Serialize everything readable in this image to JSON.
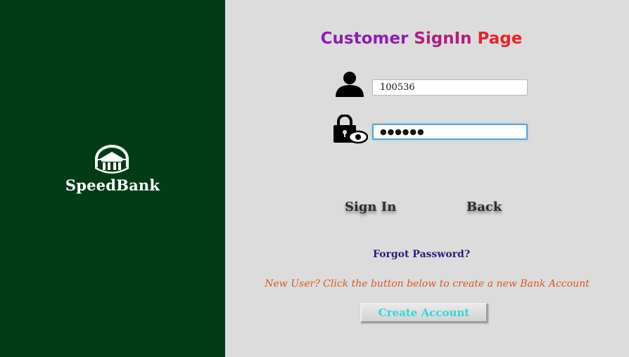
{
  "brand": {
    "name": "SpeedBank",
    "logo_icon": "bank-building-icon"
  },
  "title": {
    "part1": "Customer ",
    "part2": "SignIn",
    "part3": " Page"
  },
  "form": {
    "customer_id_value": "100536",
    "password_display": "●●●●●●",
    "user_icon": "user-icon",
    "lock_icon": "lock-eye-icon"
  },
  "buttons": {
    "sign_in": "Sign In",
    "back": "Back",
    "create_account": "Create Account"
  },
  "links": {
    "forgot_password": "Forgot Password?"
  },
  "messages": {
    "new_user": "New User? Click the button below to create a new Bank Account"
  },
  "colors": {
    "sidebar": "#023c17",
    "title_gradient_start": "#8e1eb0",
    "title_gradient_end": "#e8242a",
    "forgot": "#2a1b7a",
    "new_user": "#d55a26",
    "create_text": "#33d5e0",
    "focus_border": "#55a3da"
  }
}
